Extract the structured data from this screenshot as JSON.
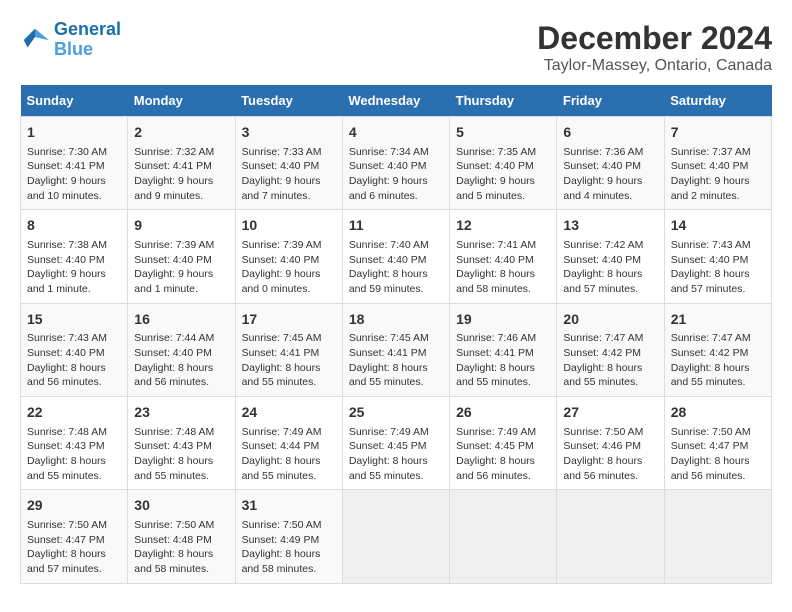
{
  "logo": {
    "line1": "General",
    "line2": "Blue"
  },
  "title": "December 2024",
  "subtitle": "Taylor-Massey, Ontario, Canada",
  "days_of_week": [
    "Sunday",
    "Monday",
    "Tuesday",
    "Wednesday",
    "Thursday",
    "Friday",
    "Saturday"
  ],
  "weeks": [
    [
      {
        "day": 1,
        "rise": "7:30 AM",
        "set": "4:41 PM",
        "daylight": "9 hours and 10 minutes."
      },
      {
        "day": 2,
        "rise": "7:32 AM",
        "set": "4:41 PM",
        "daylight": "9 hours and 9 minutes."
      },
      {
        "day": 3,
        "rise": "7:33 AM",
        "set": "4:40 PM",
        "daylight": "9 hours and 7 minutes."
      },
      {
        "day": 4,
        "rise": "7:34 AM",
        "set": "4:40 PM",
        "daylight": "9 hours and 6 minutes."
      },
      {
        "day": 5,
        "rise": "7:35 AM",
        "set": "4:40 PM",
        "daylight": "9 hours and 5 minutes."
      },
      {
        "day": 6,
        "rise": "7:36 AM",
        "set": "4:40 PM",
        "daylight": "9 hours and 4 minutes."
      },
      {
        "day": 7,
        "rise": "7:37 AM",
        "set": "4:40 PM",
        "daylight": "9 hours and 2 minutes."
      }
    ],
    [
      {
        "day": 8,
        "rise": "7:38 AM",
        "set": "4:40 PM",
        "daylight": "9 hours and 1 minute."
      },
      {
        "day": 9,
        "rise": "7:39 AM",
        "set": "4:40 PM",
        "daylight": "9 hours and 1 minute."
      },
      {
        "day": 10,
        "rise": "7:39 AM",
        "set": "4:40 PM",
        "daylight": "9 hours and 0 minutes."
      },
      {
        "day": 11,
        "rise": "7:40 AM",
        "set": "4:40 PM",
        "daylight": "8 hours and 59 minutes."
      },
      {
        "day": 12,
        "rise": "7:41 AM",
        "set": "4:40 PM",
        "daylight": "8 hours and 58 minutes."
      },
      {
        "day": 13,
        "rise": "7:42 AM",
        "set": "4:40 PM",
        "daylight": "8 hours and 57 minutes."
      },
      {
        "day": 14,
        "rise": "7:43 AM",
        "set": "4:40 PM",
        "daylight": "8 hours and 57 minutes."
      }
    ],
    [
      {
        "day": 15,
        "rise": "7:43 AM",
        "set": "4:40 PM",
        "daylight": "8 hours and 56 minutes."
      },
      {
        "day": 16,
        "rise": "7:44 AM",
        "set": "4:40 PM",
        "daylight": "8 hours and 56 minutes."
      },
      {
        "day": 17,
        "rise": "7:45 AM",
        "set": "4:41 PM",
        "daylight": "8 hours and 55 minutes."
      },
      {
        "day": 18,
        "rise": "7:45 AM",
        "set": "4:41 PM",
        "daylight": "8 hours and 55 minutes."
      },
      {
        "day": 19,
        "rise": "7:46 AM",
        "set": "4:41 PM",
        "daylight": "8 hours and 55 minutes."
      },
      {
        "day": 20,
        "rise": "7:47 AM",
        "set": "4:42 PM",
        "daylight": "8 hours and 55 minutes."
      },
      {
        "day": 21,
        "rise": "7:47 AM",
        "set": "4:42 PM",
        "daylight": "8 hours and 55 minutes."
      }
    ],
    [
      {
        "day": 22,
        "rise": "7:48 AM",
        "set": "4:43 PM",
        "daylight": "8 hours and 55 minutes."
      },
      {
        "day": 23,
        "rise": "7:48 AM",
        "set": "4:43 PM",
        "daylight": "8 hours and 55 minutes."
      },
      {
        "day": 24,
        "rise": "7:49 AM",
        "set": "4:44 PM",
        "daylight": "8 hours and 55 minutes."
      },
      {
        "day": 25,
        "rise": "7:49 AM",
        "set": "4:45 PM",
        "daylight": "8 hours and 55 minutes."
      },
      {
        "day": 26,
        "rise": "7:49 AM",
        "set": "4:45 PM",
        "daylight": "8 hours and 56 minutes."
      },
      {
        "day": 27,
        "rise": "7:50 AM",
        "set": "4:46 PM",
        "daylight": "8 hours and 56 minutes."
      },
      {
        "day": 28,
        "rise": "7:50 AM",
        "set": "4:47 PM",
        "daylight": "8 hours and 56 minutes."
      }
    ],
    [
      {
        "day": 29,
        "rise": "7:50 AM",
        "set": "4:47 PM",
        "daylight": "8 hours and 57 minutes."
      },
      {
        "day": 30,
        "rise": "7:50 AM",
        "set": "4:48 PM",
        "daylight": "8 hours and 58 minutes."
      },
      {
        "day": 31,
        "rise": "7:50 AM",
        "set": "4:49 PM",
        "daylight": "8 hours and 58 minutes."
      },
      null,
      null,
      null,
      null
    ]
  ]
}
